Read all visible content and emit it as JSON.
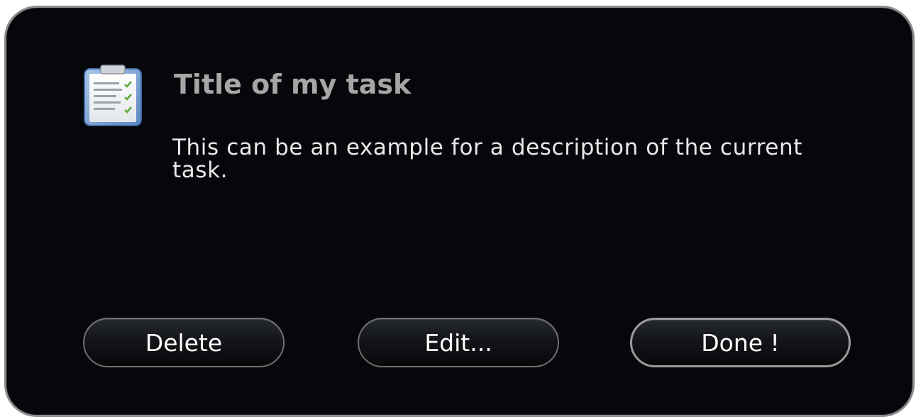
{
  "task": {
    "icon": "clipboard-checklist-icon",
    "title": "Title of my task",
    "description": "This can be an example for a description of the current task."
  },
  "buttons": {
    "delete_label": "Delete",
    "edit_label": "Edit...",
    "done_label": "Done !"
  },
  "colors": {
    "background": "#05070b",
    "border": "#8c8c8c",
    "title": "#a6a6a6",
    "text": "#e8e8e8",
    "icon_check": "#5aa83a"
  }
}
